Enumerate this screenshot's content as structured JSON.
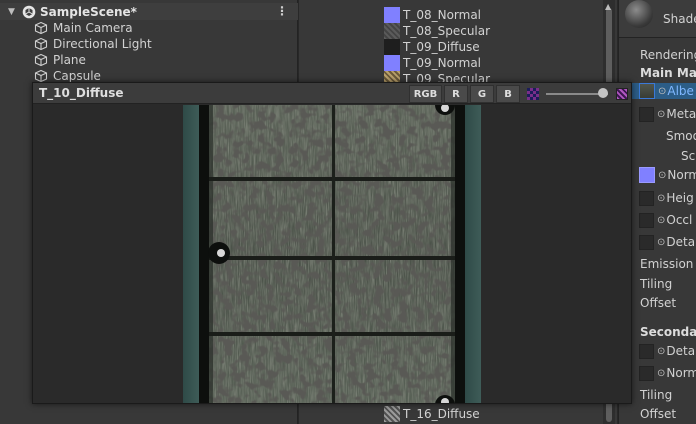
{
  "hierarchy": {
    "scene_name": "SampleScene*",
    "objects": [
      "Main Camera",
      "Directional Light",
      "Plane",
      "Capsule"
    ]
  },
  "project": {
    "assets": [
      {
        "name": "T_08_Normal",
        "kind": "normal"
      },
      {
        "name": "T_08_Specular",
        "kind": "specular"
      },
      {
        "name": "T_09_Diffuse",
        "kind": "diffuse-dark"
      },
      {
        "name": "T_09_Normal",
        "kind": "normal"
      },
      {
        "name": "T_09_Specular",
        "kind": "specular-gold"
      },
      {
        "name": "T_16_Diffuse",
        "kind": "diffuse-16"
      }
    ]
  },
  "inspector": {
    "shader_label": "Shade",
    "rendering_label": "Rendering",
    "main_maps_label": "Main Map",
    "albedo_label": "Albe",
    "metallic_label": "Meta",
    "smoothness_label": "Smoo",
    "source_label": "Sc",
    "normal_label": "Norm",
    "height_label": "Heig",
    "occlusion_label": "Occl",
    "detail_mask_label": "Deta",
    "emission_label": "Emission",
    "tiling_label": "Tiling",
    "offset_label": "Offset",
    "secondary_label": "Secondar",
    "detail_albedo_label": "Deta",
    "detail_normal_label": "Norm",
    "tiling2_label": "Tiling",
    "offset2_label": "Offset"
  },
  "preview": {
    "title": "T_10_Diffuse",
    "rgb_label": "RGB",
    "r_label": "R",
    "g_label": "G",
    "b_label": "B",
    "mip_level": 1.0
  },
  "colors": {
    "accent_blue": "#3a79d8",
    "normal_map": "#8080ff",
    "selection": "#2c5d87"
  }
}
